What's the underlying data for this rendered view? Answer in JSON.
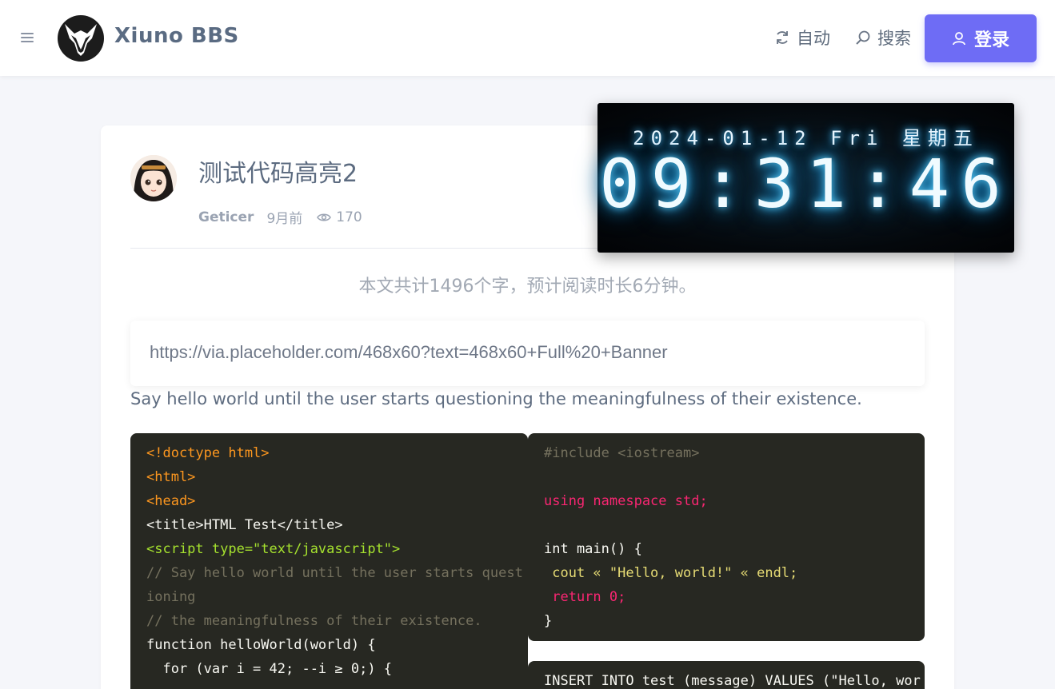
{
  "header": {
    "brand": "Xiuno BBS",
    "auto_label": "自动",
    "search_label": "搜索",
    "login_label": "登录"
  },
  "post": {
    "title": "测试代码高亮2",
    "author": "Geticer",
    "time": "9月前",
    "views": "170",
    "word_count": "本文共计1496个字，预计阅读时长6分钟。",
    "banner_url": "https://via.placeholder.com/468x60?text=468x60+Full%20+Banner",
    "intro": "Say hello world until the user starts questioning the meaningfulness of their existence."
  },
  "clock": {
    "date": "2024-01-12 Fri 星期五",
    "time": "09:31:46"
  },
  "code": {
    "html_lines": [
      "<!doctype html>",
      "<html>",
      "<head>",
      "<title>HTML Test</title>",
      "<script type=\"text/javascript\">",
      "// Say hello world until the user starts quest",
      "ioning",
      "// the meaningfulness of their existence.",
      "function helloWorld(world) {",
      "  for (var i = 42; --i ≥ 0;) {"
    ],
    "cpp_lines": [
      "#include <iostream>",
      "",
      "using namespace std;",
      "",
      "int main() {",
      " cout « \"Hello, world!\" « endl;",
      " return 0;",
      "}"
    ],
    "sql_line": "INSERT INTO test (message) VALUES (\"Hello, wor"
  },
  "colors": {
    "accent": "#6e6cf5",
    "code_bg": "#272822"
  }
}
